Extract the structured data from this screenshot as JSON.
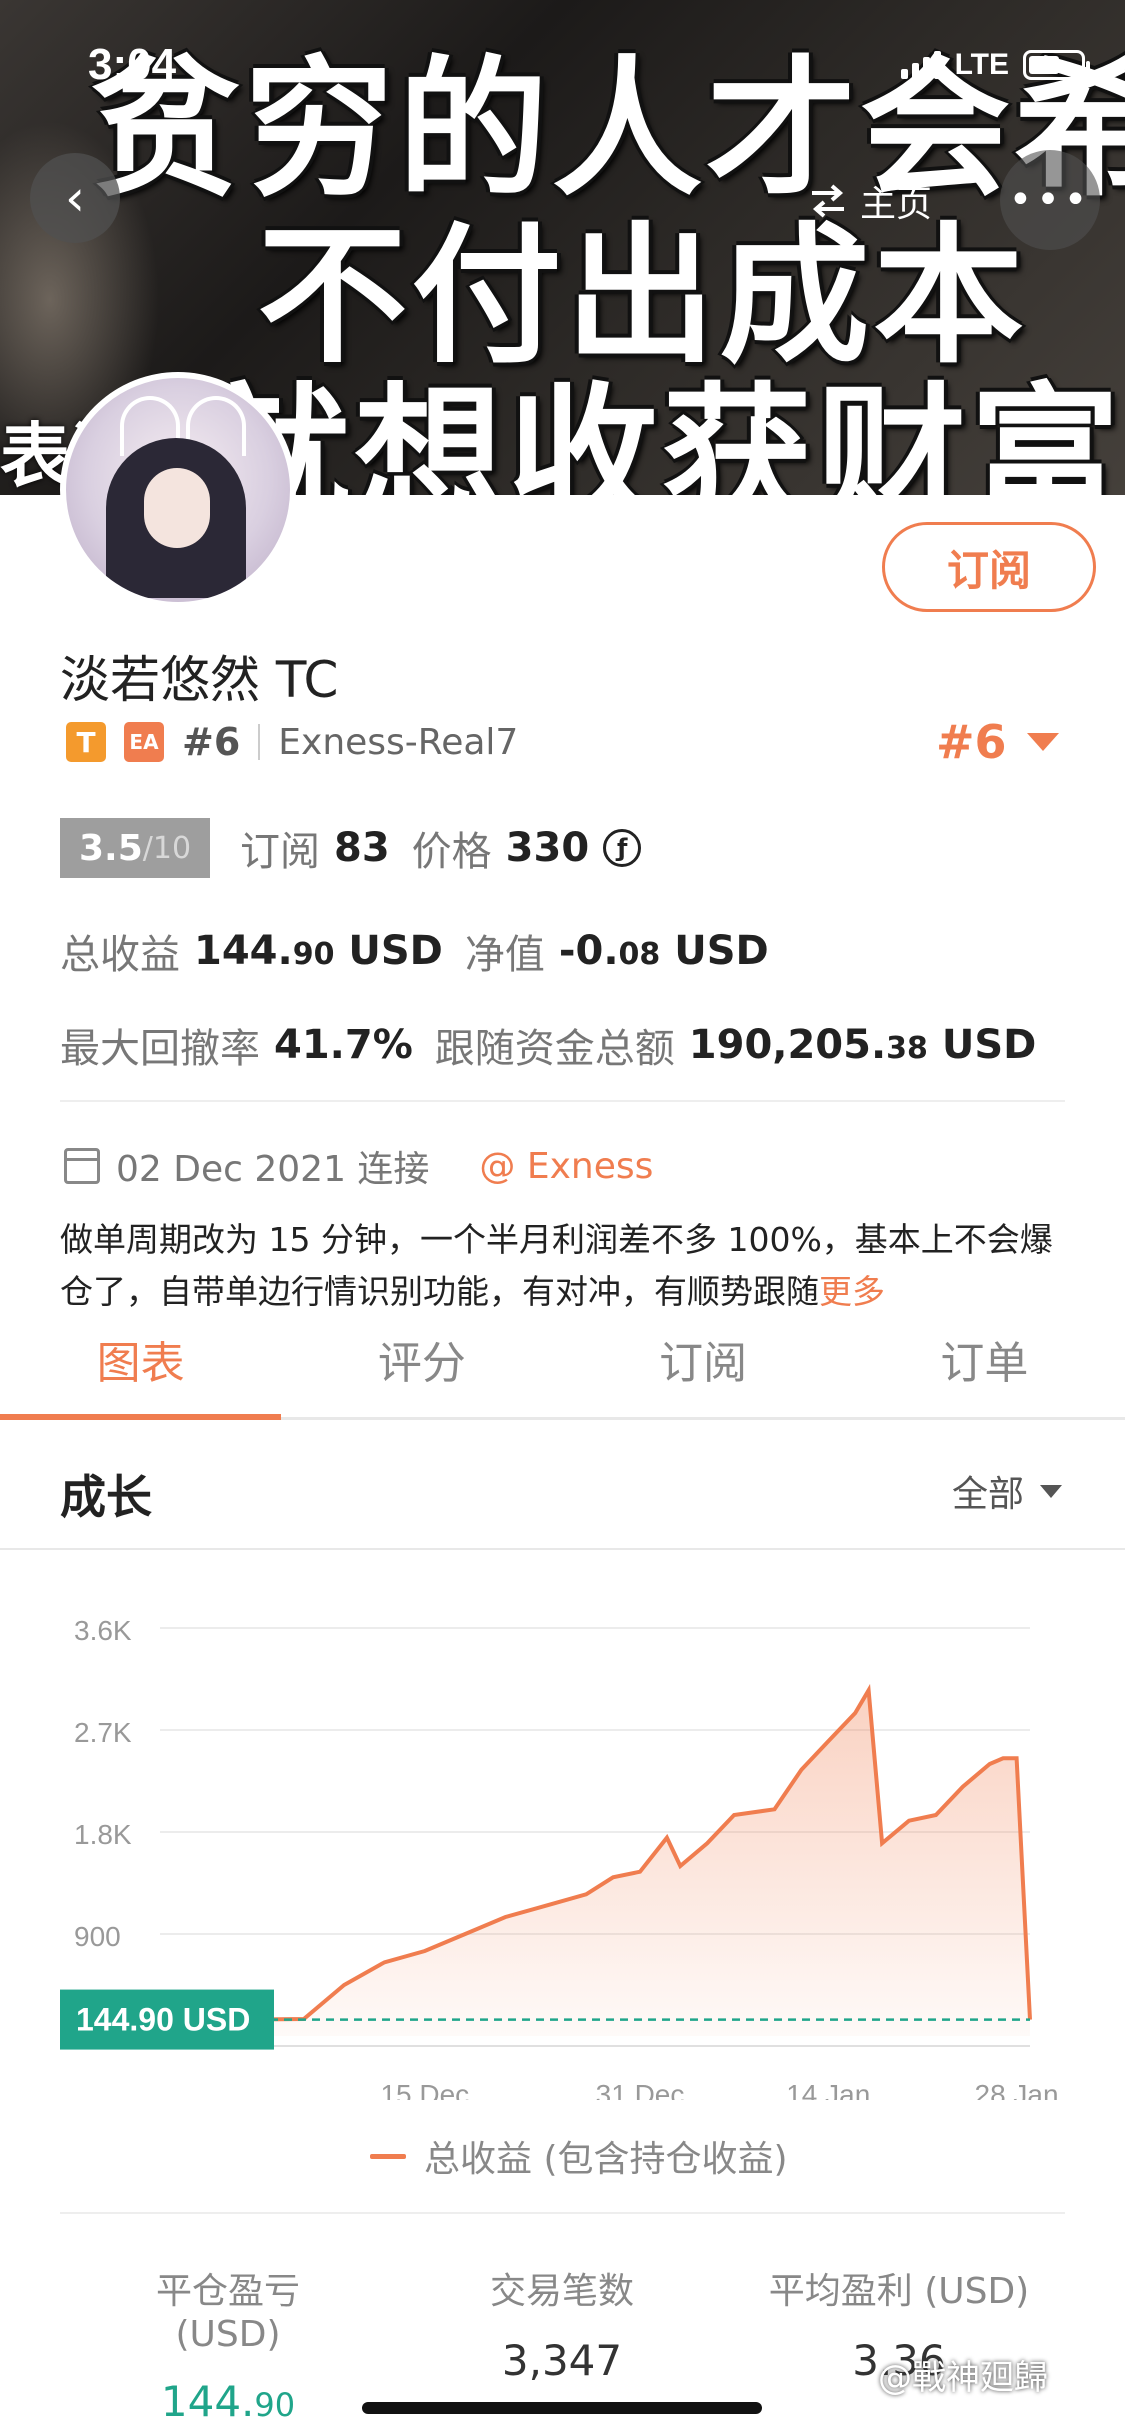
{
  "status_bar": {
    "time": "3:04",
    "network": "LTE"
  },
  "banner": {
    "line1": "贫穷的人才会希",
    "line2": "不付出成本",
    "line3": "就想收获财富",
    "side": "表演"
  },
  "nav": {
    "back_label": "‹",
    "home_label": "主页",
    "more_label": "•••"
  },
  "profile": {
    "name": "淡若悠然 TC",
    "tag_t": "T",
    "tag_ea": "EA",
    "rank": "#6",
    "account": "Exness-Real7",
    "rank_right": "#6",
    "subscribe_label": "订阅"
  },
  "stats_row1": {
    "score": "3.5",
    "score_max": "/10",
    "subs_label": "订阅",
    "subs_value": "83",
    "price_label": "价格",
    "price_value": "330",
    "coin_symbol": "ƒ"
  },
  "stats_row2": {
    "total_label": "总收益",
    "total_int": "144.",
    "total_dec": "90",
    "total_unit": "USD",
    "net_label": "净值",
    "net_int": "-0.",
    "net_dec": "08",
    "net_unit": "USD"
  },
  "stats_row3": {
    "dd_label": "最大回撤率",
    "dd_value": "41.7%",
    "follow_label": "跟随资金总额",
    "follow_int": "190,205.",
    "follow_dec": "38",
    "follow_unit": "USD"
  },
  "connect": {
    "date": "02 Dec 2021 连接",
    "broker": "@ Exness"
  },
  "description": {
    "text": "做单周期改为 15 分钟，一个半月利润差不多 100%，基本上不会爆仓了，自带单边行情识别功能，有对冲，有顺势跟随",
    "more": "更多"
  },
  "tabs": [
    "图表",
    "评分",
    "订阅",
    "订单"
  ],
  "section": {
    "title": "成长",
    "filter": "全部"
  },
  "colors": {
    "accent": "#f07d4f",
    "green": "#20a58a",
    "chart_line": "#f07d4f"
  },
  "chart_data": {
    "type": "area",
    "title": "",
    "xlabel": "",
    "ylabel": "",
    "yticks": [
      "3.6K",
      "2.7K",
      "1.8K",
      "900"
    ],
    "ytick_values": [
      3600,
      2700,
      1800,
      900
    ],
    "xticks": [
      "15 Dec",
      "31 Dec",
      "14 Jan",
      "28 Jan"
    ],
    "ylim": [
      0,
      3600
    ],
    "current_label": "144.90 USD",
    "current_value": 144.9,
    "legend": "总收益 (包含持仓收益)",
    "series": [
      {
        "name": "总收益 (包含持仓收益)",
        "x": [
          "02 Dec",
          "06 Dec",
          "09 Dec",
          "12 Dec",
          "15 Dec",
          "18 Dec",
          "21 Dec",
          "24 Dec",
          "27 Dec",
          "29 Dec",
          "31 Dec",
          "02 Jan",
          "03 Jan",
          "05 Jan",
          "07 Jan",
          "10 Jan",
          "12 Jan",
          "14 Jan",
          "16 Jan",
          "17 Jan",
          "18 Jan",
          "20 Jan",
          "22 Jan",
          "24 Jan",
          "26 Jan",
          "27 Jan",
          "28 Jan",
          "29 Jan"
        ],
        "values": [
          0,
          150,
          450,
          650,
          750,
          900,
          1050,
          1150,
          1250,
          1400,
          1450,
          1750,
          1500,
          1700,
          1950,
          2000,
          2350,
          2600,
          2850,
          3050,
          1700,
          1900,
          1950,
          2200,
          2400,
          2450,
          2450,
          144.9
        ]
      }
    ]
  },
  "bottom_stats": [
    {
      "label": "平仓盈亏 (USD)",
      "int": "144.",
      "dec": "90"
    },
    {
      "label": "交易笔数",
      "value": "3,347"
    },
    {
      "label": "平均盈利 (USD)",
      "value": "3.36"
    }
  ],
  "watermark": "@戰神廻歸"
}
